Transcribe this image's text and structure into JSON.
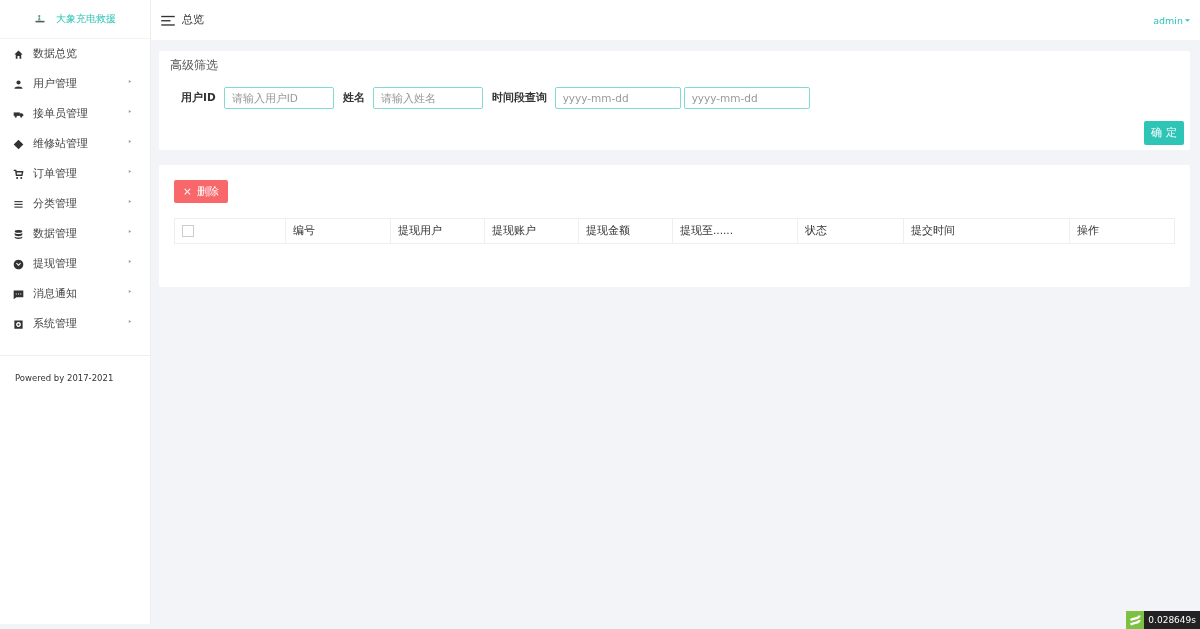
{
  "brand": {
    "title": "大象充电救援"
  },
  "sidebar": {
    "items": [
      {
        "label": "数据总览"
      },
      {
        "label": "用户管理"
      },
      {
        "label": "接单员管理"
      },
      {
        "label": "维修站管理"
      },
      {
        "label": "订单管理"
      },
      {
        "label": "分类管理"
      },
      {
        "label": "数据管理"
      },
      {
        "label": "提现管理"
      },
      {
        "label": "消息通知"
      },
      {
        "label": "系统管理"
      }
    ],
    "footer": "Powered by 2017-2021"
  },
  "header": {
    "title": "总览",
    "user": "admin"
  },
  "filter": {
    "title": "高级筛选",
    "fields": [
      {
        "label": "用户ID",
        "placeholder": "请输入用户ID"
      },
      {
        "label": "姓名",
        "placeholder": "请输入姓名"
      },
      {
        "label": "时间段查询",
        "placeholder": "yyyy-mm-dd"
      },
      {
        "placeholder": "yyyy-mm-dd"
      }
    ],
    "confirm": "确 定"
  },
  "table": {
    "delete_icon": "×",
    "delete_label": "删除",
    "select_all_checked": false,
    "columns": [
      "编号",
      "提现用户",
      "提现账户",
      "提现金额",
      "提现至......",
      "状态",
      "提交时间",
      "操作"
    ]
  },
  "trace": {
    "time": "0.028649s"
  }
}
